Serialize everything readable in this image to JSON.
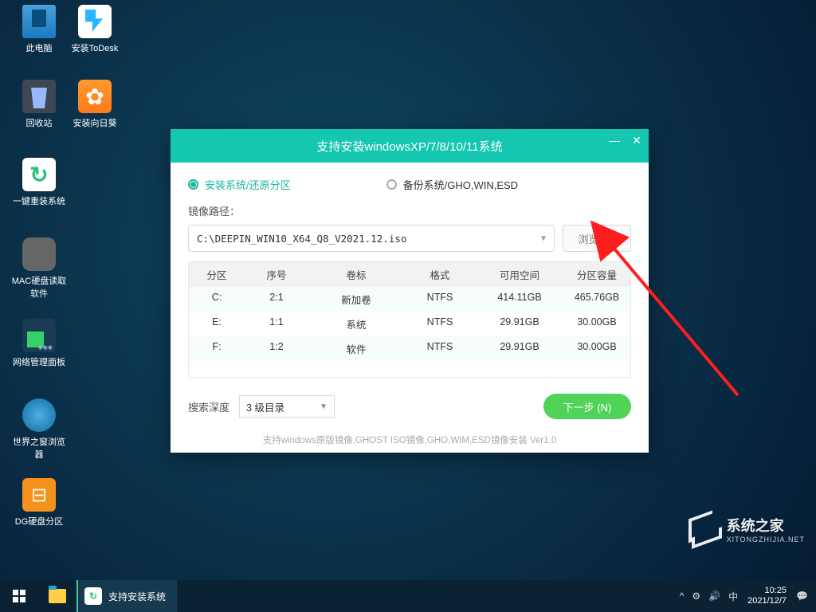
{
  "desktop_icons": {
    "this_pc": "此电脑",
    "install_todesk": "安装ToDesk",
    "recycle_bin": "回收站",
    "install_sunflower": "安装向日葵",
    "one_key_reinstall": "一键重装系统",
    "mac_disk_reader": "MAC硬盘读取软件",
    "network_panel": "网络管理面板",
    "world_browser": "世界之窗浏览器",
    "dg_partition": "DG硬盘分区"
  },
  "dialog": {
    "title": "支持安装windowsXP/7/8/10/11系统",
    "radio_install": "安装系统/还原分区",
    "radio_backup": "备份系统/GHO,WIN,ESD",
    "image_path_label": "镜像路径：",
    "image_path_value": "C:\\DEEPIN_WIN10_X64_Q8_V2021.12.iso",
    "browse": "浏览 (B)",
    "table_head": {
      "partition": "分区",
      "serial": "序号",
      "label": "卷标",
      "format": "格式",
      "free": "可用空间",
      "size": "分区容量"
    },
    "rows": [
      {
        "partition": "C:",
        "serial": "2:1",
        "label": "新加卷",
        "format": "NTFS",
        "free": "414.11GB",
        "size": "465.76GB"
      },
      {
        "partition": "E:",
        "serial": "1:1",
        "label": "系统",
        "format": "NTFS",
        "free": "29.91GB",
        "size": "30.00GB"
      },
      {
        "partition": "F:",
        "serial": "1:2",
        "label": "软件",
        "format": "NTFS",
        "free": "29.91GB",
        "size": "30.00GB"
      }
    ],
    "search_depth_label": "搜索深度",
    "search_depth_value": "3 级目录",
    "next": "下一步 (N)",
    "footer": "支持windows原版镜像,GHOST ISO镜像,GHO,WIM,ESD镜像安装 Ver1.0"
  },
  "taskbar": {
    "app_title": "支持安装系统",
    "time": "10:25",
    "date": "2021/12/7"
  },
  "watermark": {
    "brand": "系统之家",
    "sub": "XITONGZHIJIA.NET"
  }
}
